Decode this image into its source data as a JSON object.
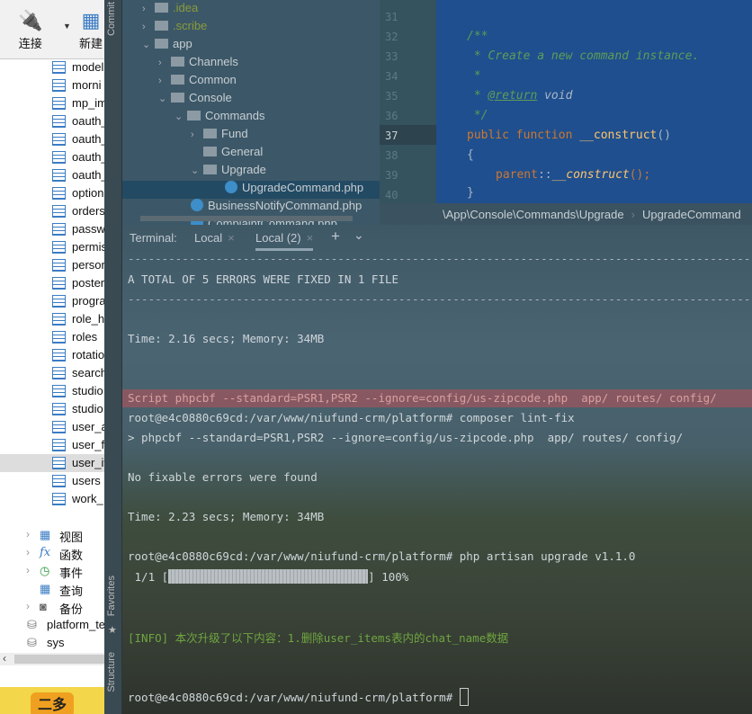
{
  "navicat": {
    "toolbar": [
      {
        "label": "连接",
        "icon": "plug-icon"
      },
      {
        "label": "新建",
        "icon": "new-table-icon"
      }
    ],
    "tables": [
      "model",
      "morni",
      "mp_im",
      "oauth_",
      "oauth_",
      "oauth_",
      "oauth_",
      "option",
      "orders",
      "passw",
      "permis",
      "person",
      "poster",
      "progra",
      "role_h",
      "roles",
      "rotatio",
      "search",
      "studio",
      "studio",
      "user_a",
      "user_fe",
      "user_it",
      "users",
      "work_"
    ],
    "selected_table": "user_it",
    "tree": [
      {
        "label": "视图",
        "icon": "view-icon"
      },
      {
        "label": "函数",
        "icon": "function-icon"
      },
      {
        "label": "事件",
        "icon": "event-clock-icon"
      },
      {
        "label": "查询",
        "icon": "query-icon"
      },
      {
        "label": "备份",
        "icon": "backup-icon"
      }
    ],
    "databases": [
      "platform_te",
      "sys"
    ],
    "taskbar_app": "二多"
  },
  "ide": {
    "side_labels": {
      "commit": "Commit",
      "favorites": "Favorites",
      "structure": "Structure"
    },
    "project_tree": [
      {
        "label": ".idea",
        "depth": 0,
        "type": "folder",
        "state": "collapsed"
      },
      {
        "label": ".scribe",
        "depth": 0,
        "type": "folder",
        "state": "collapsed"
      },
      {
        "label": "app",
        "depth": 0,
        "type": "folder",
        "state": "expanded"
      },
      {
        "label": "Channels",
        "depth": 1,
        "type": "folder",
        "state": "collapsed"
      },
      {
        "label": "Common",
        "depth": 1,
        "type": "folder",
        "state": "collapsed"
      },
      {
        "label": "Console",
        "depth": 1,
        "type": "folder",
        "state": "expanded"
      },
      {
        "label": "Commands",
        "depth": 2,
        "type": "folder",
        "state": "expanded"
      },
      {
        "label": "Fund",
        "depth": 3,
        "type": "folder",
        "state": "collapsed"
      },
      {
        "label": "General",
        "depth": 3,
        "type": "folder",
        "state": "none"
      },
      {
        "label": "Upgrade",
        "depth": 3,
        "type": "folder",
        "state": "expanded"
      },
      {
        "label": "UpgradeCommand.php",
        "depth": 4,
        "type": "php",
        "selected": true
      },
      {
        "label": "BusinessNotifyCommand.php",
        "depth": 3,
        "type": "php"
      },
      {
        "label": "ComplaintCommand.php",
        "depth": 3,
        "type": "php"
      }
    ],
    "line_numbers": [
      "31",
      "32",
      "33",
      "34",
      "35",
      "36",
      "37",
      "38",
      "39",
      "40"
    ],
    "current_line": "37",
    "code": {
      "l32": "/**",
      "l33": " * Create a new command instance.",
      "l34": " *",
      "l35_tag": "@return",
      "l35_rest": " void",
      "l36": " */",
      "l37_kw1": "public",
      "l37_kw2": "function",
      "l37_name": "__construct",
      "l37_rest": "()",
      "l38": "{",
      "l39_kw": "parent",
      "l39_mid": "::",
      "l39_fn": "__construct",
      "l39_rest": "();",
      "l40": "}"
    },
    "breadcrumb": [
      "\\App\\Console\\Commands\\Upgrade",
      "UpgradeCommand"
    ],
    "terminal": {
      "label": "Terminal:",
      "tabs": [
        "Local",
        "Local (2)"
      ],
      "active_tab": "Local (2)",
      "add": "+",
      "more": "⌄",
      "lines": {
        "dash1": "------------------------------------------------------------------------------------------------",
        "total": "A TOTAL OF 5 ERRORS WERE FIXED IN 1 FILE",
        "dash2": "------------------------------------------------------------------------------------------------",
        "time1": "Time: 2.16 secs; Memory: 34MB",
        "script": "Script phpcbf --standard=PSR1,PSR2 --ignore=config/us-zipcode.php  app/ routes/ config/",
        "cmd1": "root@e4c0880c69cd:/var/www/niufund-crm/platform# composer lint-fix",
        "phpcbf": "> phpcbf --standard=PSR1,PSR2 --ignore=config/us-zipcode.php  app/ routes/ config/",
        "nofix": "No fixable errors were found",
        "time2": "Time: 2.23 secs; Memory: 34MB",
        "cmd2": "root@e4c0880c69cd:/var/www/niufund-crm/platform# php artisan upgrade v1.1.0",
        "progress_prefix": " 1/1 [",
        "progress_suffix": "] 100%",
        "info": "[INFO] 本次升级了以下内容：1.删除user_items表内的chat_name数据",
        "prompt": "root@e4c0880c69cd:/var/www/niufund-crm/platform# "
      },
      "progress_percent": 100
    }
  }
}
